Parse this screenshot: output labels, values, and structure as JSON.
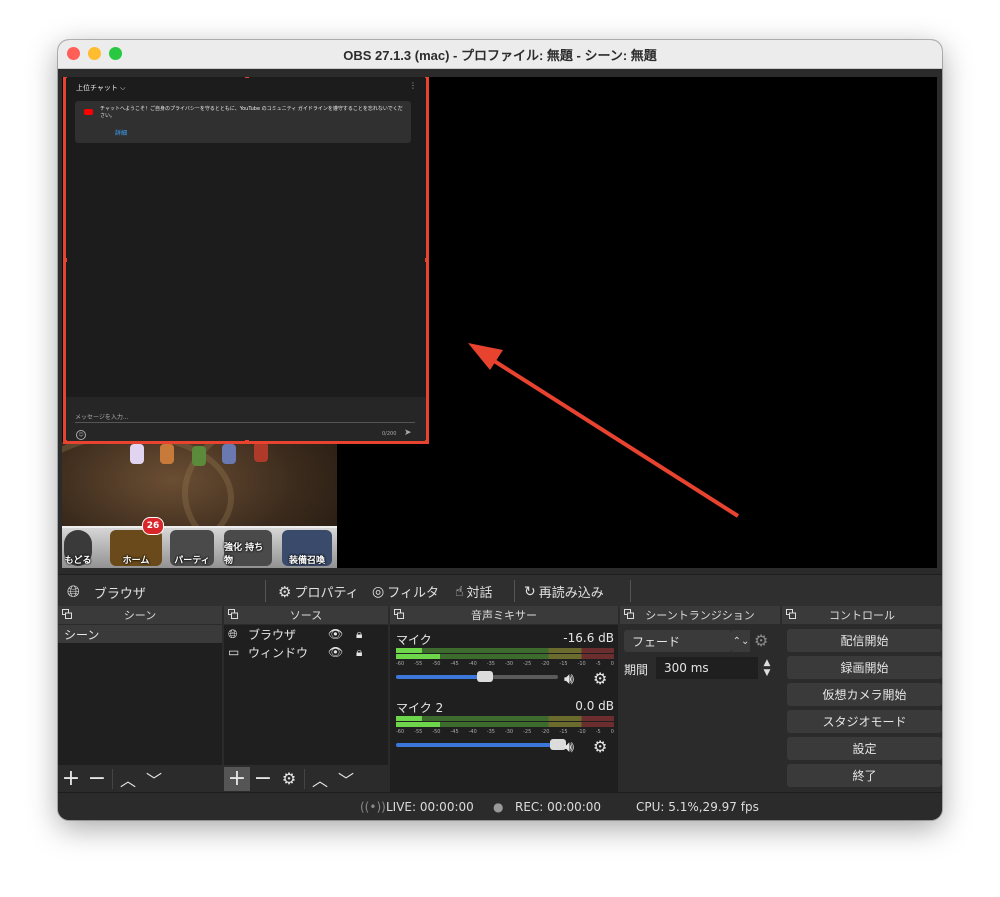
{
  "window": {
    "title": "OBS 27.1.3 (mac) - プロファイル: 無題 - シーン: 無題",
    "traffic_lights": {
      "close": "#ff5f57",
      "minimize": "#febc2e",
      "zoom": "#28c840"
    }
  },
  "preview": {
    "chat": {
      "header_label": "上位チャット",
      "more_icon": "vertical-dots-icon",
      "welcome_text": "チャットへようこそ！ご自身のプライバシーを守るとともに、YouTube のコミュニティ ガイドラインを遵守することを忘れないでください。",
      "welcome_link": "詳細",
      "input_placeholder": "メッセージを入力...",
      "char_count": "0/200"
    },
    "game": {
      "buttons": [
        "もどる",
        "ホーム",
        "パーティ",
        "強化 持ち物",
        "装備召喚"
      ],
      "badge": "26"
    },
    "selection_color": "#e8432e"
  },
  "source_toolbar": {
    "source_name": "ブラウザ",
    "properties": "プロパティ",
    "filters": "フィルタ",
    "interact": "対話",
    "reload": "再読み込み"
  },
  "scenes": {
    "title": "シーン",
    "items": [
      "シーン"
    ]
  },
  "sources": {
    "title": "ソース",
    "items": [
      {
        "name": "ブラウザ",
        "icon": "globe-icon"
      },
      {
        "name": "ウィンドウ",
        "icon": "window-icon"
      }
    ]
  },
  "mixer": {
    "title": "音声ミキサー",
    "channels": [
      {
        "name": "マイク",
        "db": "-16.6 dB",
        "level": 0.55
      },
      {
        "name": "マイク 2",
        "db": "0.0 dB",
        "level": 1.0
      }
    ],
    "scale": [
      "-60",
      "-55",
      "-50",
      "-45",
      "-40",
      "-35",
      "-30",
      "-25",
      "-20",
      "-15",
      "-10",
      "-5",
      "0"
    ]
  },
  "transitions": {
    "title": "シーントランジション",
    "selected": "フェード",
    "duration_label": "期間",
    "duration_value": "300 ms"
  },
  "controls": {
    "title": "コントロール",
    "buttons": [
      "配信開始",
      "録画開始",
      "仮想カメラ開始",
      "スタジオモード",
      "設定",
      "終了"
    ]
  },
  "status": {
    "live": "LIVE: 00:00:00",
    "rec": "REC: 00:00:00",
    "cpu": "CPU: 5.1%,29.97 fps"
  }
}
